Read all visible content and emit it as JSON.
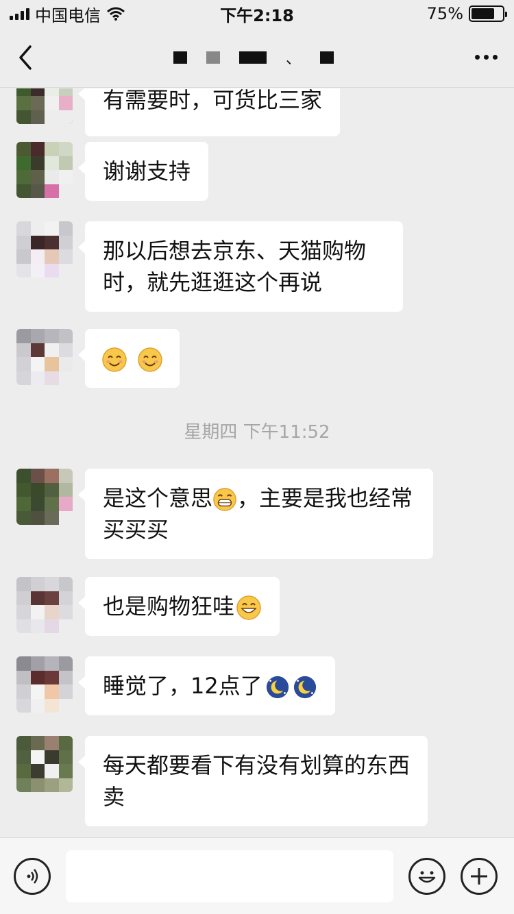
{
  "status_bar": {
    "carrier": "中国电信",
    "time": "下午2:18",
    "battery_percent": "75%",
    "battery_level": 0.75
  },
  "nav": {
    "title_redacted": true,
    "title_separator": "、"
  },
  "messages": [
    {
      "text": "有需要时，可货比三家"
    },
    {
      "text": "谢谢支持"
    },
    {
      "text": "那以后想去京东、天猫购物时，就先逛逛这个再说"
    },
    {
      "emoji": [
        "smiling-face-icon",
        "smiling-face-icon"
      ]
    },
    {
      "text": "是这个意思",
      "emoji_mid": "grinning-face-icon",
      "text_after": "，主要是我也经常买买买"
    },
    {
      "text": "也是购物狂哇",
      "emoji_end": "grin-face-icon"
    },
    {
      "text": "睡觉了，12点了",
      "emoji_end": [
        "moon-icon",
        "moon-icon"
      ]
    },
    {
      "text": "每天都要看下有没有划算的东西卖"
    }
  ],
  "timestamp": "星期四 下午11:52",
  "input_bar": {
    "placeholder": ""
  },
  "colors": {
    "background": "#ededed",
    "bubble": "#ffffff",
    "timestamp": "#a6a6a6"
  }
}
